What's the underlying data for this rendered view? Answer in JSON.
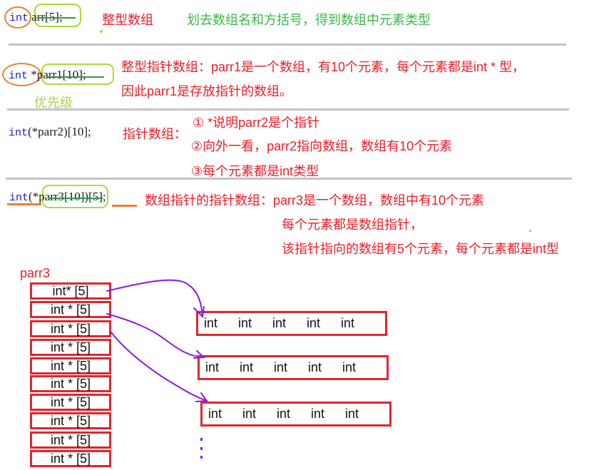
{
  "sections": [
    {
      "code": {
        "kw": "int",
        "rest": "arr[5]",
        "tail": ";"
      },
      "label_red": "整型数组",
      "label_green": "划去数组名和方括号，得到数组中元素类型"
    },
    {
      "code": {
        "kw": "int",
        "star": " *",
        "rest": "parr1[10]",
        "tail": ";"
      },
      "note_lime": "优先级",
      "desc": [
        "整型指针数组：parr1是一个数组，有10个元素，每个元素都是int * 型，",
        "因此parr1是存放指针的数组。"
      ]
    },
    {
      "code": {
        "kw": "int",
        "rest": "(*parr2)[10];"
      },
      "label_red": "指针数组：",
      "steps": [
        "① *说明parr2是个指针",
        "②向外一看，parr2指向数组，数组有10个元素",
        "③每个元素都是int类型"
      ]
    },
    {
      "code": {
        "kw": "int",
        "open": "(*",
        "rest": "parr3[10]",
        "close": ")[5];"
      },
      "desc": [
        "数组指针的指针数组：parr3是一个数组，数组中有10个元素",
        "每个元素都是数组指针，",
        "该指针指向的数组有5个元素，每个元素都是int型"
      ]
    }
  ],
  "diagram": {
    "array_name": "parr3",
    "cells": [
      "int* [5]",
      "int * [5]",
      "int * [5]",
      "int * [5]",
      "int * [5]",
      "int * [5]",
      "int * [5]",
      "int * [5]",
      "int * [5]",
      "int * [5]"
    ],
    "targets": [
      [
        "int",
        "int",
        "int",
        "int",
        "int"
      ],
      [
        "int",
        "int",
        "int",
        "int",
        "int"
      ],
      [
        "int",
        "int",
        "int",
        "int",
        "int"
      ]
    ],
    "ellipsis": "⋮"
  },
  "colors": {
    "red": "#e8202a",
    "green": "#3cb64a",
    "lime": "#aadc3c",
    "orange": "#f08030",
    "purple": "#8a1ae6",
    "keyword": "#1a1acc"
  }
}
